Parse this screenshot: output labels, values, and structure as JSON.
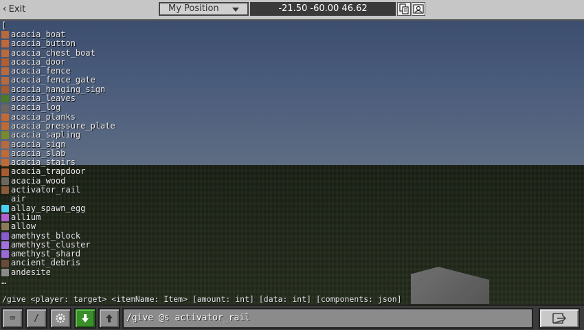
{
  "topbar": {
    "exit_label": "Exit",
    "position_select": "My Position",
    "coordinates": "-21.50 -60.00 46.62"
  },
  "list": {
    "open_bracket": "[",
    "items": [
      {
        "label": "acacia_boat",
        "color": "#b86a3c"
      },
      {
        "label": "acacia_button",
        "color": "#c06838"
      },
      {
        "label": "acacia_chest_boat",
        "color": "#b86a3c"
      },
      {
        "label": "acacia_door",
        "color": "#b25e30"
      },
      {
        "label": "acacia_fence",
        "color": "#b86a3c"
      },
      {
        "label": "acacia_fence_gate",
        "color": "#b86a3c"
      },
      {
        "label": "acacia_hanging_sign",
        "color": "#a85a30"
      },
      {
        "label": "acacia_leaves",
        "color": "#4a7a24"
      },
      {
        "label": "acacia_log",
        "color": "#6e6660"
      },
      {
        "label": "acacia_planks",
        "color": "#c06a36"
      },
      {
        "label": "acacia_pressure_plate",
        "color": "#c06a36"
      },
      {
        "label": "acacia_sapling",
        "color": "#7a8a2a"
      },
      {
        "label": "acacia_sign",
        "color": "#b86a3c"
      },
      {
        "label": "acacia_slab",
        "color": "#c06a36"
      },
      {
        "label": "acacia_stairs",
        "color": "#c06a36"
      },
      {
        "label": "acacia_trapdoor",
        "color": "#a85a30"
      },
      {
        "label": "acacia_wood",
        "color": "#6e6660"
      },
      {
        "label": "activator_rail",
        "color": "#8a5a3a"
      },
      {
        "label": "air",
        "color": ""
      },
      {
        "label": "allay_spawn_egg",
        "color": "#4ad0f0"
      },
      {
        "label": "allium",
        "color": "#b060d0"
      },
      {
        "label": "allow",
        "color": "#8a7a5a"
      },
      {
        "label": "amethyst_block",
        "color": "#8a5ad0"
      },
      {
        "label": "amethyst_cluster",
        "color": "#a070e0"
      },
      {
        "label": "amethyst_shard",
        "color": "#9a68d8"
      },
      {
        "label": "ancient_debris",
        "color": "#6a4a3a"
      },
      {
        "label": "andesite",
        "color": "#8a8a8a"
      }
    ],
    "more": "…"
  },
  "hint": "/give <player: target> <itemName: Item> [amount: int] [data: int] [components: json]",
  "bottombar": {
    "keyboard_glyph": "⌨",
    "slash_label": "/",
    "command_value": "/give @s activator_rail"
  },
  "colors": {
    "accent_green": "#3a8f2a"
  }
}
